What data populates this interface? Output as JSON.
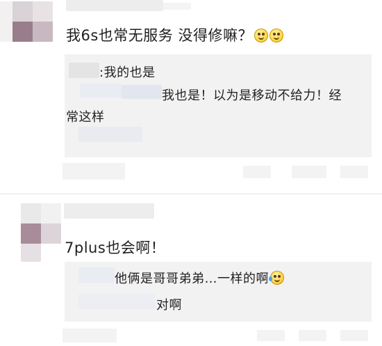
{
  "comments": [
    {
      "text": "我6s也常无服务 没得修嘛？",
      "emoji": [
        "sweat-smile-icon",
        "sweat-smile-icon"
      ],
      "replies": [
        {
          "text": ":我的也是"
        },
        {
          "text_line1": "我也是！以为是移动不给力！经",
          "text_line2": "常这样"
        }
      ]
    },
    {
      "text": "7plus也会啊！",
      "emoji": [],
      "replies": [
        {
          "text": "他俩是哥哥弟弟…一样的啊",
          "emoji": "laugh-cry-icon"
        },
        {
          "text": "对啊"
        }
      ]
    }
  ],
  "colors": {
    "reply_box_bg": "#f2f2f2",
    "text": "#1f1f1f",
    "divider": "#e6e6e6"
  }
}
